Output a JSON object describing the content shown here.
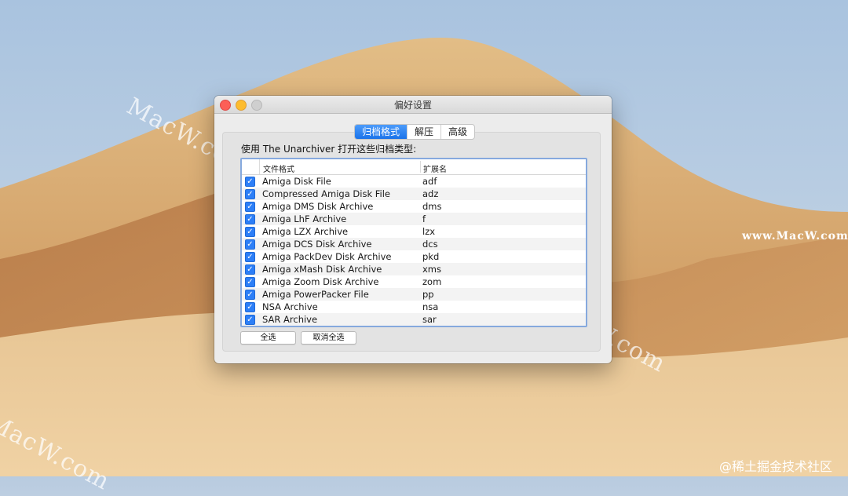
{
  "watermarks": {
    "diagonal": "MacW.com",
    "side": "www.MacW.com",
    "bottom_right": "@稀土掘金技术社区"
  },
  "window": {
    "title": "偏好设置",
    "traffic_lights": {
      "close": "#fc5f57",
      "minimize": "#fdbc2e",
      "zoom": "#cfcfcf"
    }
  },
  "tabs": [
    {
      "label": "归档格式",
      "active": true
    },
    {
      "label": "解压",
      "active": false
    },
    {
      "label": "高级",
      "active": false
    }
  ],
  "description": "使用 The Unarchiver 打开这些归档类型:",
  "table": {
    "headers": {
      "name": "文件格式",
      "ext": "扩展名"
    },
    "rows": [
      {
        "checked": true,
        "name": "Amiga Disk File",
        "ext": "adf"
      },
      {
        "checked": true,
        "name": "Compressed Amiga Disk File",
        "ext": "adz"
      },
      {
        "checked": true,
        "name": "Amiga DMS Disk Archive",
        "ext": "dms"
      },
      {
        "checked": true,
        "name": "Amiga LhF Archive",
        "ext": "f"
      },
      {
        "checked": true,
        "name": "Amiga LZX Archive",
        "ext": "lzx"
      },
      {
        "checked": true,
        "name": "Amiga DCS Disk Archive",
        "ext": "dcs"
      },
      {
        "checked": true,
        "name": "Amiga PackDev Disk Archive",
        "ext": "pkd"
      },
      {
        "checked": true,
        "name": "Amiga xMash Disk Archive",
        "ext": "xms"
      },
      {
        "checked": true,
        "name": "Amiga Zoom Disk Archive",
        "ext": "zom"
      },
      {
        "checked": true,
        "name": "Amiga PowerPacker File",
        "ext": "pp"
      },
      {
        "checked": true,
        "name": "NSA Archive",
        "ext": "nsa"
      },
      {
        "checked": true,
        "name": "SAR Archive",
        "ext": "sar"
      }
    ]
  },
  "buttons": {
    "select_all": "全选",
    "deselect_all": "取消全选"
  },
  "colors": {
    "accent": "#1a73ea",
    "focus_ring": "#86a9de"
  }
}
